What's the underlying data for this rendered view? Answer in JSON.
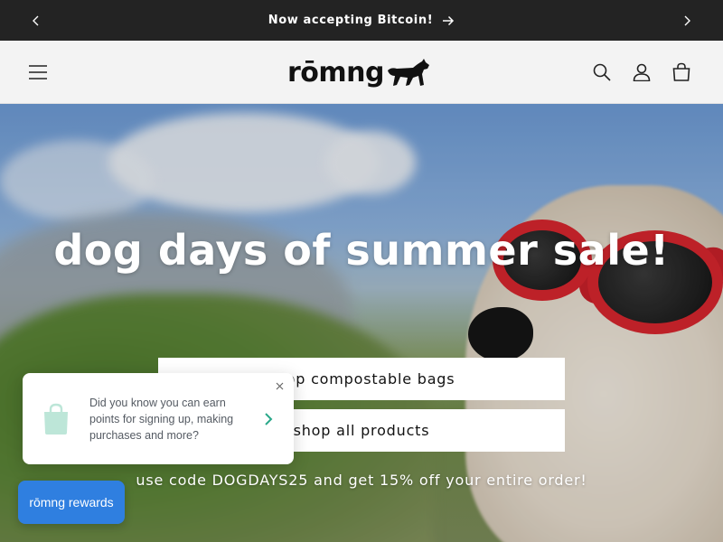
{
  "announcement": {
    "text": "Now accepting Bitcoin!",
    "prev_icon": "chevron-left-icon",
    "next_icon": "chevron-right-icon",
    "link_icon": "arrow-right-icon"
  },
  "header": {
    "logo_text": "rōmng",
    "menu_icon": "hamburger-icon",
    "icons": [
      "search-icon",
      "account-icon",
      "cart-icon"
    ]
  },
  "hero": {
    "title": "dog days of summer sale!",
    "primary_button": "shop compostable bags",
    "secondary_button": "shop all products",
    "promo_text": "use code DOGDAYS25 and get 15% off your entire order!"
  },
  "rewards_popup": {
    "message": "Did you know you can earn points for signing up, making purchases and more?",
    "close_icon": "close-icon",
    "bag_icon": "shopping-bag-icon",
    "action_icon": "chevron-right-icon",
    "accent_color": "#2aa88a"
  },
  "rewards_launcher": {
    "label": "rōmng rewards",
    "color": "#2f7fe0"
  },
  "colors": {
    "announcement_bg": "#232323",
    "header_bg": "#f3f3f3"
  }
}
